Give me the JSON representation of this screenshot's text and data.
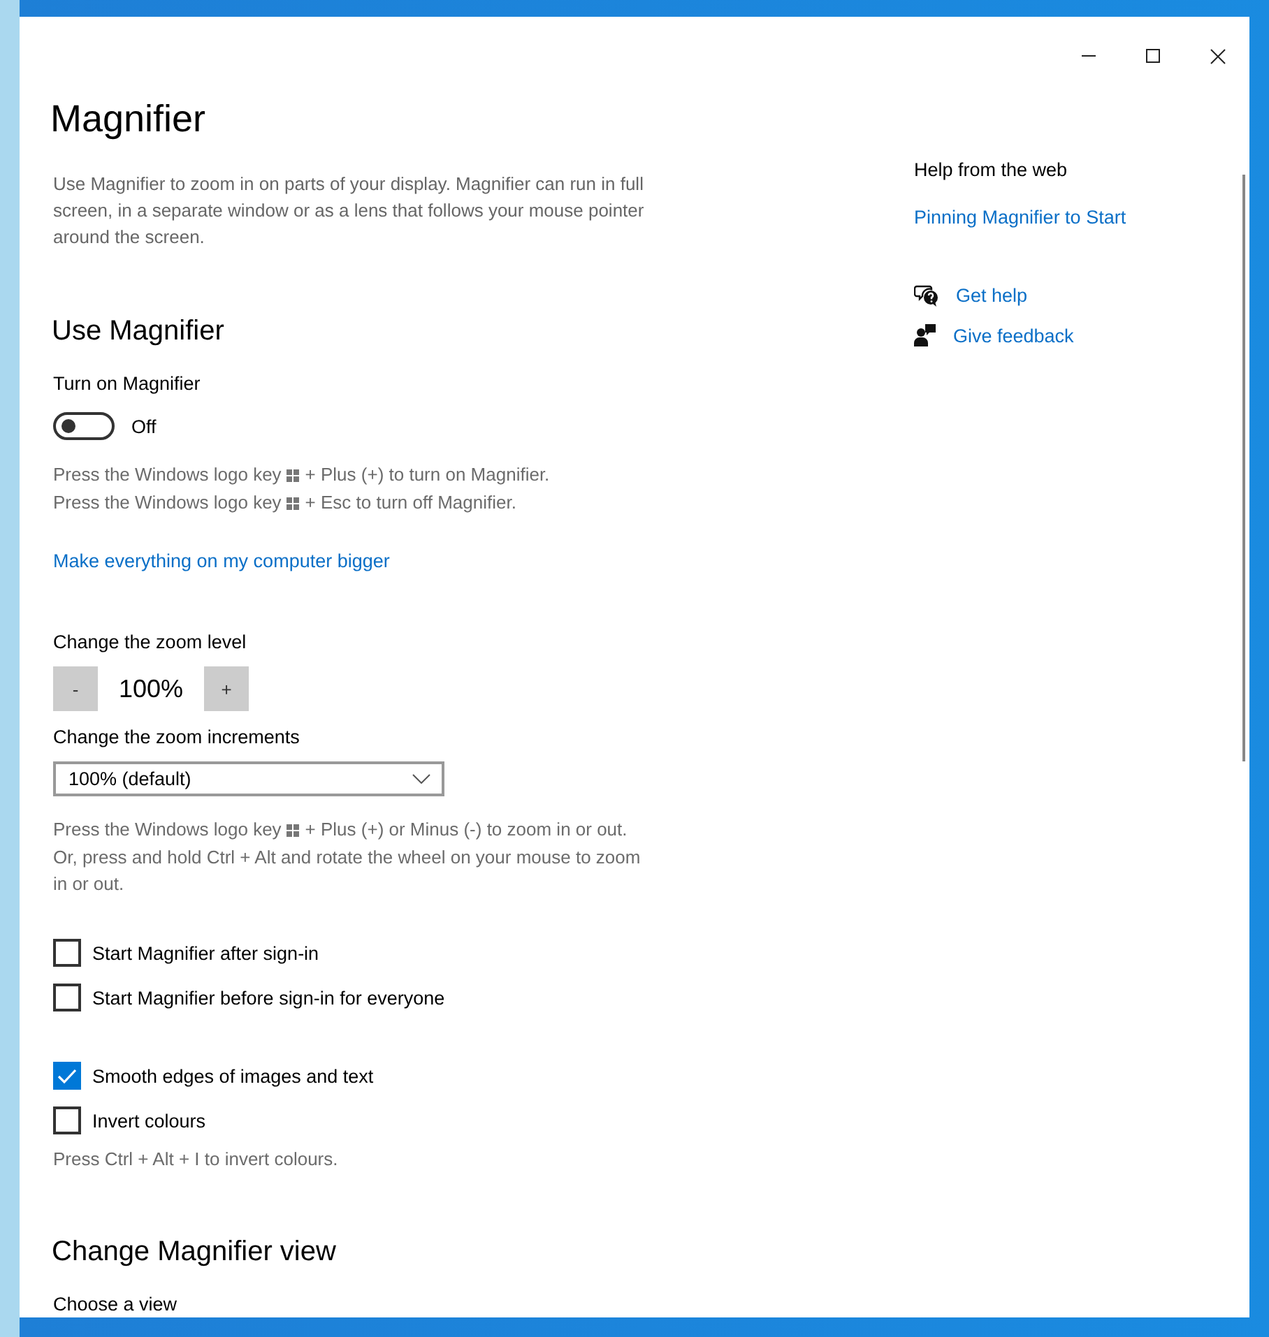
{
  "window": {
    "title": "Magnifier",
    "description": "Use Magnifier to zoom in on parts of your display. Magnifier can run in full screen, in a separate window or as a lens that follows your mouse pointer around the screen."
  },
  "use_magnifier": {
    "heading": "Use Magnifier",
    "toggle": {
      "label": "Turn on Magnifier",
      "on": false,
      "state_text": "Off"
    },
    "hints": [
      {
        "before": "Press the Windows logo key",
        "after": "+ Plus (+) to turn on Magnifier."
      },
      {
        "before": "Press the Windows logo key",
        "after": "+ Esc to turn off Magnifier."
      }
    ],
    "link": "Make everything on my computer bigger",
    "zoom": {
      "label": "Change the zoom level",
      "minus": "-",
      "value": "100%",
      "plus": "+"
    },
    "increments": {
      "label": "Change the zoom increments",
      "value": "100% (default)"
    },
    "zoom_hints": [
      {
        "before": "Press the Windows logo key",
        "after": "+ Plus (+) or Minus (-) to zoom in or out."
      },
      {
        "text": "Or, press and hold Ctrl + Alt and rotate the wheel on your mouse to zoom in or out."
      }
    ],
    "checkbox_groups": [
      [
        {
          "label": "Start Magnifier after sign-in",
          "checked": false
        },
        {
          "label": "Start Magnifier before sign-in for everyone",
          "checked": false
        }
      ],
      [
        {
          "label": "Smooth edges of images and text",
          "checked": true
        },
        {
          "label": "Invert colours",
          "checked": false
        }
      ]
    ],
    "invert_hint": "Press Ctrl + Alt + I to invert colours."
  },
  "change_view": {
    "heading": "Change Magnifier view",
    "label": "Choose a view"
  },
  "sidebar": {
    "heading": "Help from the web",
    "link": "Pinning Magnifier to Start",
    "actions": [
      {
        "kind": "help",
        "label": "Get help"
      },
      {
        "kind": "feedback",
        "label": "Give feedback"
      }
    ]
  }
}
